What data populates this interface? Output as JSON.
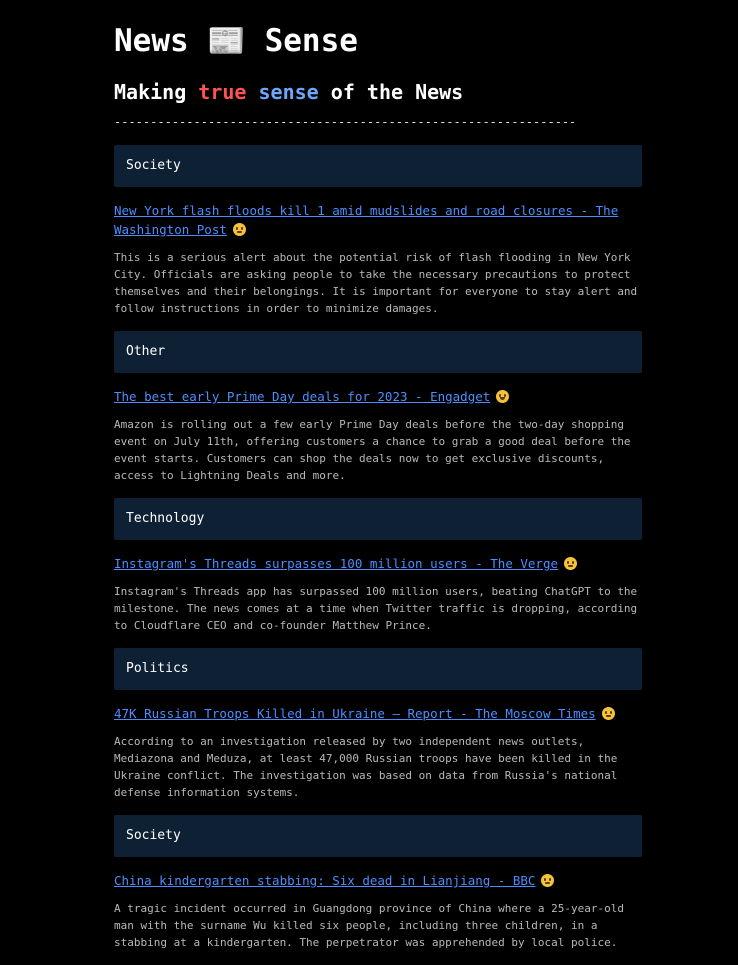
{
  "site": {
    "title": "News 📰 Sense",
    "tagline_prefix": "Making ",
    "tagline_true": "true",
    "tagline_space": " ",
    "tagline_sense": "sense",
    "tagline_suffix": " of the News",
    "divider": "------------------------------------------------------------------------",
    "colors": {
      "background": "#000000",
      "category_bg": "#0e2033",
      "link": "#4d8dff",
      "true_word": "#ff5252",
      "sense_word": "#6ea8fe"
    }
  },
  "articles": [
    {
      "category": "Society",
      "headline": "New York flash floods kill 1 amid mudslides and road closures - The Washington Post",
      "sentiment_icon": "worried-face-icon",
      "summary": "This is a serious alert about the potential risk of flash flooding in New York City. Officials are asking people to take the necessary precautions to protect themselves and their belongings. It is important for everyone to stay alert and follow instructions in order to minimize damages."
    },
    {
      "category": "Other",
      "headline": "The best early Prime Day deals for 2023 - Engadget",
      "sentiment_icon": "grinning-face-icon",
      "summary": "Amazon is rolling out a few early Prime Day deals before the two-day shopping event on July 11th, offering customers a chance to grab a good deal before the event starts. Customers can shop the deals now to get exclusive discounts, access to Lightning Deals and more."
    },
    {
      "category": "Technology",
      "headline": "Instagram's Threads surpasses 100 million users - The Verge",
      "sentiment_icon": "neutral-face-icon",
      "summary": "Instagram's Threads app has surpassed 100 million users, beating ChatGPT to the milestone. The news comes at a time when Twitter traffic is dropping, according to Cloudflare CEO and co-founder Matthew Prince."
    },
    {
      "category": "Politics",
      "headline": "47K Russian Troops Killed in Ukraine – Report - The Moscow Times",
      "sentiment_icon": "sad-face-icon",
      "summary": "According to an investigation released by two independent news outlets, Mediazona and Meduza, at least 47,000 Russian troops have been killed in the Ukraine conflict. The investigation was based on data from Russia's national defense information systems."
    },
    {
      "category": "Society",
      "headline": "China kindergarten stabbing: Six dead in Lianjiang - BBC",
      "sentiment_icon": "sad-face-icon",
      "summary": "A tragic incident occurred in Guangdong province of China where a 25-year-old man with the surname Wu killed six people, including three children, in a stabbing at a kindergarten. The perpetrator was apprehended by local police."
    }
  ]
}
